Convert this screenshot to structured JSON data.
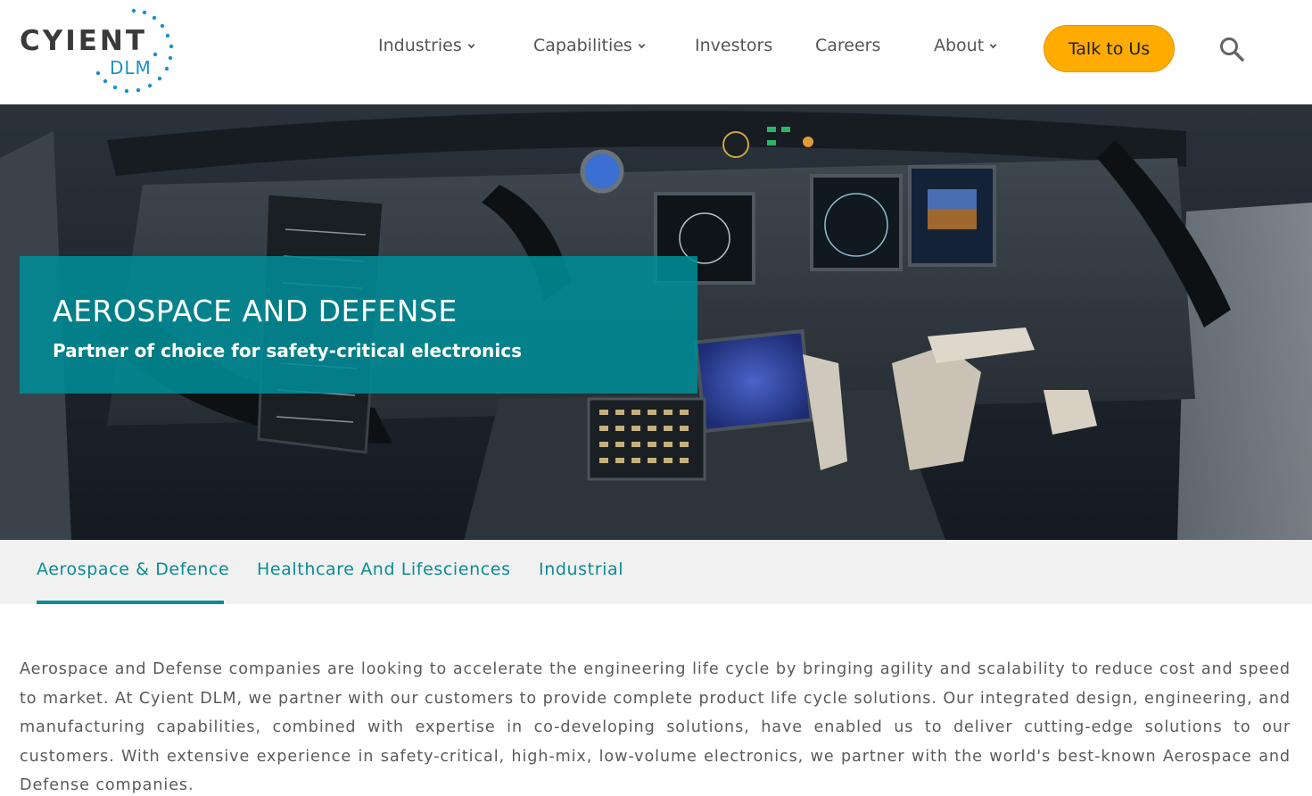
{
  "logo": {
    "brand": "CYIENT",
    "sub": "DLM"
  },
  "nav": {
    "items": [
      {
        "label": "Industries",
        "dropdown": true
      },
      {
        "label": "Capabilities",
        "dropdown": true
      },
      {
        "label": "Investors",
        "dropdown": false
      },
      {
        "label": "Careers",
        "dropdown": false
      },
      {
        "label": "About",
        "dropdown": true
      }
    ],
    "cta_label": "Talk to Us"
  },
  "hero": {
    "title": "AEROSPACE AND DEFENSE",
    "subtitle": "Partner of choice for safety-critical electronics"
  },
  "tabs": [
    {
      "label": "Aerospace & Defence",
      "active": true
    },
    {
      "label": "Healthcare And Lifesciences",
      "active": false
    },
    {
      "label": "Industrial",
      "active": false
    }
  ],
  "content": {
    "paragraph": "Aerospace and Defense companies are looking to accelerate the engineering life cycle by bringing agility and scalability to reduce cost and speed to market. At Cyient DLM, we partner with our customers to provide complete product life cycle solutions. Our integrated design, engineering, and manufacturing capabilities, combined with expertise in co-developing solutions, have enabled us to deliver cutting-edge solutions to our customers. With extensive experience in safety-critical, high-mix, low-volume electronics, we partner with the world's best-known Aerospace and Defense companies."
  },
  "colors": {
    "accent_teal": "#0a8c95",
    "cta_yellow": "#ffab00",
    "logo_blue": "#1a8fc9"
  },
  "icons": {
    "search": "search-icon",
    "dropdown": "chevron-down-icon"
  }
}
